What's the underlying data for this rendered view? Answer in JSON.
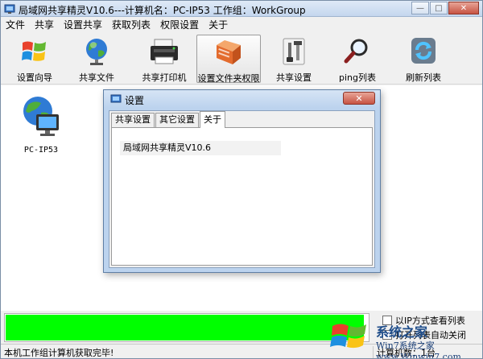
{
  "window": {
    "title": "局域网共享精灵V10.6---计算机名：PC-IP53  工作组：WorkGroup",
    "close_glyph": "✕",
    "minimize_glyph": "—",
    "maximize_glyph": "□"
  },
  "menu": [
    {
      "label": "文件"
    },
    {
      "label": "共享"
    },
    {
      "label": "设置共享"
    },
    {
      "label": "获取列表"
    },
    {
      "label": "权限设置"
    },
    {
      "label": "关于"
    }
  ],
  "toolbar": [
    {
      "label": "设置向导",
      "icon": "windows-logo-icon"
    },
    {
      "label": "共享文件",
      "icon": "globe-icon"
    },
    {
      "label": "共享打印机",
      "icon": "printer-icon"
    },
    {
      "label": "设置文件夹权限",
      "icon": "folder-permission-icon",
      "active": true
    },
    {
      "label": "共享设置",
      "icon": "tools-icon"
    },
    {
      "label": "ping列表",
      "icon": "magnifier-icon"
    },
    {
      "label": "刷新列表",
      "icon": "refresh-icon"
    }
  ],
  "computers": [
    {
      "name": "PC-IP53"
    }
  ],
  "dialog": {
    "title": "设置",
    "close_glyph": "✕",
    "tabs": [
      {
        "label": "共享设置"
      },
      {
        "label": "其它设置"
      },
      {
        "label": "关于",
        "active": true
      }
    ],
    "about_text": "局域网共享精灵V10.6"
  },
  "progress": {
    "fraction": 0.99
  },
  "options": [
    {
      "label": "以IP方式查看列表",
      "checked": false
    },
    {
      "label": "打开列表自动关闭",
      "checked": true
    }
  ],
  "status": {
    "left": "本机工作组计算机获取完毕!",
    "right": "计算机数：1台"
  },
  "watermark": {
    "brand": "系统之家",
    "url": "Win7系统之家 www.Winwin7.com"
  },
  "colors": {
    "progress": "#00ff00",
    "accent": "#bcd3ee"
  }
}
